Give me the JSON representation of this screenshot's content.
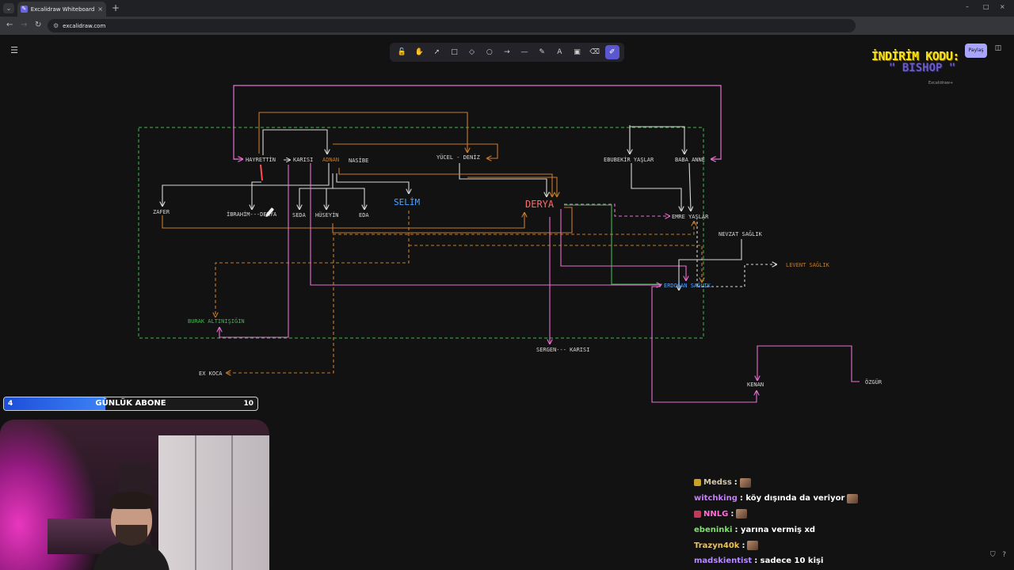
{
  "browser": {
    "tab_title": "Excalidraw Whiteboard",
    "tab_close": "×",
    "new_tab": "+",
    "url": "excalidraw.com",
    "win_min": "–",
    "win_max": "□",
    "win_close": "×"
  },
  "toolbar": {
    "tools": [
      {
        "name": "lock-icon",
        "glyph": "🔓"
      },
      {
        "name": "hand-icon",
        "glyph": "✋"
      },
      {
        "name": "selection-icon",
        "glyph": "➚"
      },
      {
        "name": "rectangle-icon",
        "glyph": "□"
      },
      {
        "name": "diamond-icon",
        "glyph": "◇"
      },
      {
        "name": "ellipse-icon",
        "glyph": "○"
      },
      {
        "name": "arrow-icon",
        "glyph": "→"
      },
      {
        "name": "line-icon",
        "glyph": "—"
      },
      {
        "name": "pencil-icon",
        "glyph": "✎"
      },
      {
        "name": "text-icon",
        "glyph": "A"
      },
      {
        "name": "image-icon",
        "glyph": "▣"
      },
      {
        "name": "eraser-icon",
        "glyph": "⌫"
      },
      {
        "name": "laser-icon",
        "glyph": "✐"
      }
    ],
    "active_index": 12,
    "share_label": "Paylaş"
  },
  "promo": {
    "line1": "İNDİRİM KODU:",
    "line2": "\" BISHOP \"",
    "collab": "Excalidraw+"
  },
  "diagram": {
    "nodes": {
      "hayrettin": "HAYRETTİN",
      "karisi1": "KARISI",
      "adnan": "ADNAN",
      "nasibe": "NASİBE",
      "yucel_deniz": "YÜCEL - DENİZ",
      "ebubekir": "EBUBEKİR YAŞLAR",
      "baba_anne": "BABA ANNE",
      "zafer": "ZAFER",
      "ibrahim_derya": "İBRAHİM---DERYA",
      "seda": "SEDA",
      "huseyin": "HÜSEYİN",
      "eda": "EDA",
      "selim": "SELİM",
      "derya": "DERYA",
      "emre": "EMRE YAŞLAR",
      "nevzat": "NEVZAT SAĞLIK",
      "levent": "LEVENT SAĞLIK",
      "erdogan": "ERDOĞAN SAĞLIK",
      "burak": "BURAK ALTINIŞIĞIN",
      "sergen": "SERGEN--- KARISI",
      "ex_koca": "EX KOCA",
      "kenan": "KENAN",
      "ozgur": "ÖZGÜR"
    },
    "colors": {
      "pink": "#e76fd2",
      "white": "#d8d8d8",
      "orange": "#c77a2a",
      "green": "#3fb950",
      "blue": "#4da3ff",
      "red": "#ff4d4d",
      "derya": "#ff6b6b"
    }
  },
  "sub_goal": {
    "label": "GÜNLÜK ABONE",
    "current": "4",
    "goal": "10",
    "progress": 0.4
  },
  "chat": [
    {
      "user": "Medss",
      "color": "#d2c6a6",
      "text": " :",
      "badge": "#c9a227",
      "emote": true
    },
    {
      "user": "witchking",
      "color": "#c77dff",
      "text": " : köy dışında da veriyor",
      "badge": "",
      "emote": true
    },
    {
      "user": "NNLG",
      "color": "#ff6bd6",
      "text": " :",
      "badge": "#c0395b",
      "emote": true
    },
    {
      "user": "ebeninki",
      "color": "#7ee36b",
      "text": " : yarına vermiş xd",
      "badge": "",
      "emote": false
    },
    {
      "user": "Trazyn40k",
      "color": "#f2c14e",
      "text": " :",
      "badge": "",
      "emote": true
    },
    {
      "user": "madskientist",
      "color": "#b48cff",
      "text": " : sadece 10 kişi",
      "badge": "",
      "emote": false
    }
  ]
}
